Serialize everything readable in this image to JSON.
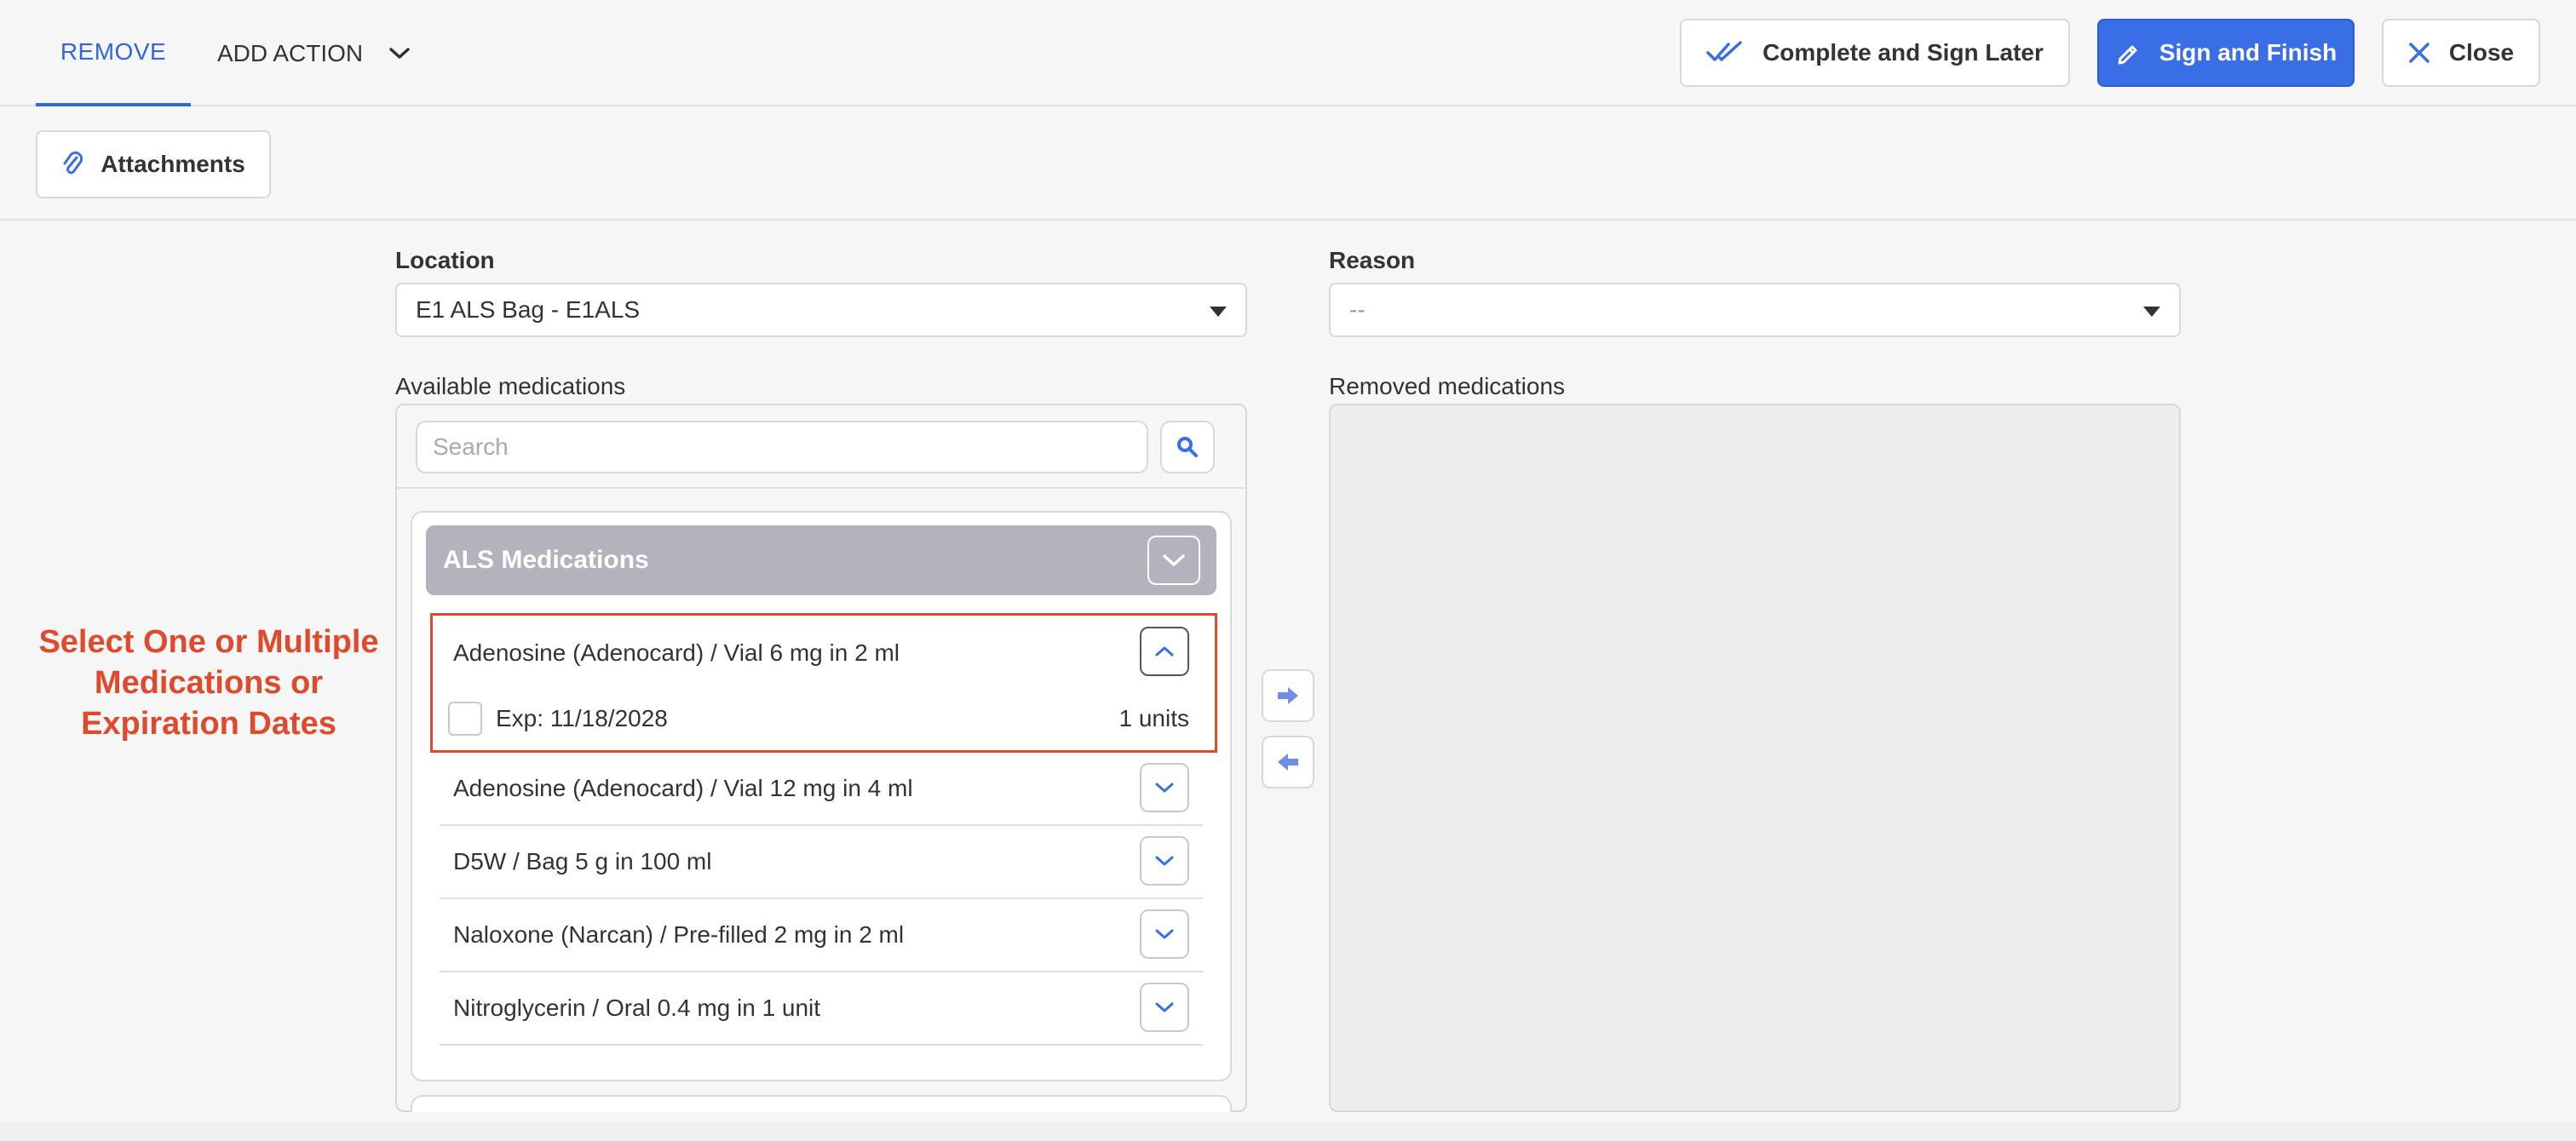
{
  "topbar": {
    "tab_remove": "REMOVE",
    "tab_add_action": "ADD ACTION",
    "btn_complete_later": "Complete and Sign Later",
    "btn_sign_finish": "Sign and Finish",
    "btn_close": "Close"
  },
  "secondbar": {
    "btn_attachments": "Attachments"
  },
  "form": {
    "location_label": "Location",
    "location_value": "E1 ALS Bag - E1ALS",
    "reason_label": "Reason",
    "reason_value": "--",
    "available_label": "Available medications",
    "removed_label": "Removed medications",
    "search_placeholder": "Search"
  },
  "group": {
    "title": "ALS Medications"
  },
  "medications": [
    {
      "name": "Adenosine (Adenocard) / Vial 6 mg in 2 ml",
      "expanded": true
    },
    {
      "name": "Adenosine (Adenocard) / Vial 12 mg in 4 ml",
      "expanded": false
    },
    {
      "name": "D5W / Bag 5 g in 100 ml",
      "expanded": false
    },
    {
      "name": "Naloxone (Narcan) / Pre-filled 2 mg in 2 ml",
      "expanded": false
    },
    {
      "name": "Nitroglycerin / Oral 0.4 mg in 1 unit",
      "expanded": false
    }
  ],
  "expiration": {
    "label": "Exp: 11/18/2028",
    "units": "1 units"
  },
  "annotation": {
    "line1": "Select One or Multiple",
    "line2": "Medications or",
    "line3": "Expiration Dates"
  },
  "colors": {
    "accent": "#3a6ee6",
    "annotation": "#e04a2c",
    "group_header": "#b3b3be"
  }
}
